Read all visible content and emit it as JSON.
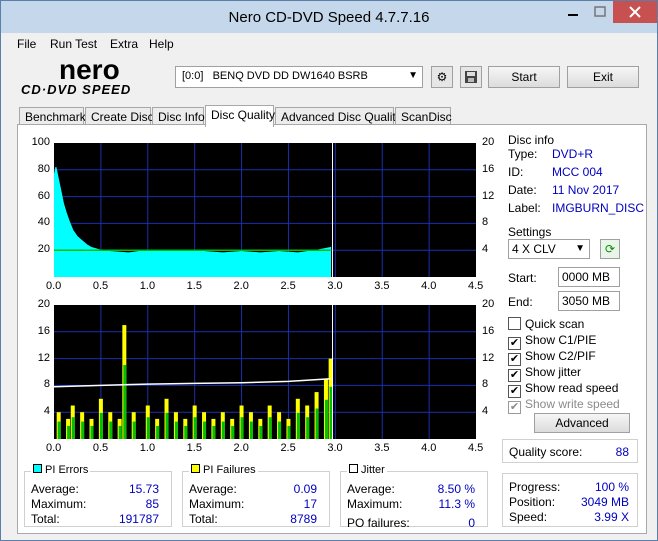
{
  "window": {
    "title": "Nero CD-DVD Speed 4.7.7.16",
    "accent": "#c5d7ea"
  },
  "menu": [
    "File",
    "Run Test",
    "Extra",
    "Help"
  ],
  "logo": {
    "brand": "nero",
    "product": "CD·DVD SPEED"
  },
  "drive": {
    "selected": "[0:0]   BENQ DVD DD DW1640 BSRB"
  },
  "toolbar": {
    "start_label": "Start",
    "exit_label": "Exit"
  },
  "tabs": [
    "Benchmark",
    "Create Disc",
    "Disc Info",
    "Disc Quality",
    "Advanced Disc Quality",
    "ScanDisc"
  ],
  "active_tab": "Disc Quality",
  "disc_info": {
    "title": "Disc info",
    "type_label": "Type:",
    "type": "DVD+R",
    "id_label": "ID:",
    "id": "MCC 004",
    "date_label": "Date:",
    "date": "11 Nov 2017",
    "label_label": "Label:",
    "label": "IMGBURN_DISC"
  },
  "settings": {
    "title": "Settings",
    "speed": "4 X CLV",
    "start_label": "Start:",
    "start": "0000 MB",
    "end_label": "End:",
    "end": "3050 MB",
    "quick_scan": "Quick scan",
    "show_c1": "Show C1/PIE",
    "show_c2": "Show C2/PIF",
    "show_jitter": "Show jitter",
    "show_read": "Show read speed",
    "show_write": "Show write speed",
    "advanced_label": "Advanced"
  },
  "quality": {
    "label": "Quality score:",
    "value": "88"
  },
  "progress": {
    "progress_label": "Progress:",
    "progress": "100 %",
    "position_label": "Position:",
    "position": "3049 MB",
    "speed_label": "Speed:",
    "speed": "3.99 X"
  },
  "pi_errors": {
    "title": "PI Errors",
    "color": "#00ffff",
    "avg_label": "Average:",
    "avg": "15.73",
    "max_label": "Maximum:",
    "max": "85",
    "total_label": "Total:",
    "total": "191787"
  },
  "pi_failures": {
    "title": "PI Failures",
    "color": "#ffff00",
    "avg_label": "Average:",
    "avg": "0.09",
    "max_label": "Maximum:",
    "max": "17",
    "total_label": "Total:",
    "total": "8789"
  },
  "jitter": {
    "title": "Jitter",
    "avg_label": "Average:",
    "avg": "8.50 %",
    "max_label": "Maximum:",
    "max": "11.3 %",
    "po_label": "PO failures:",
    "po": "0"
  },
  "chart_data": [
    {
      "type": "area",
      "series": [
        {
          "name": "PI Errors",
          "color": "#00ffff",
          "x": [
            0.0,
            0.02,
            0.05,
            0.08,
            0.1,
            0.13,
            0.16,
            0.2,
            0.25,
            0.3,
            0.35,
            0.4,
            0.5,
            0.6,
            0.8,
            1.0,
            1.2,
            1.4,
            1.6,
            1.8,
            2.0,
            2.2,
            2.4,
            2.6,
            2.8,
            2.95
          ],
          "values": [
            75,
            82,
            72,
            62,
            55,
            48,
            42,
            35,
            30,
            27,
            24,
            22,
            20,
            19,
            18,
            20,
            19,
            20,
            19,
            18,
            19,
            18,
            19,
            18,
            20,
            22
          ]
        },
        {
          "name": "Read speed",
          "color": "#00c000",
          "x": [
            0.0,
            2.95
          ],
          "values": [
            4,
            4
          ]
        }
      ],
      "xlim": [
        0,
        4.5
      ],
      "ylim": [
        0,
        100
      ],
      "y2lim": [
        0,
        20
      ],
      "xticks": [
        "0.0",
        "0.5",
        "1.0",
        "1.5",
        "2.0",
        "2.5",
        "3.0",
        "3.5",
        "4.0",
        "4.5"
      ],
      "yticks": [
        "20",
        "40",
        "60",
        "80",
        "100"
      ],
      "y2ticks": [
        "4",
        "8",
        "12",
        "16",
        "20"
      ],
      "grid": true
    },
    {
      "type": "bar",
      "series": [
        {
          "name": "PI Failures",
          "color": "#ffff00",
          "x": [
            0.05,
            0.15,
            0.2,
            0.3,
            0.4,
            0.5,
            0.6,
            0.7,
            0.75,
            0.85,
            1.0,
            1.1,
            1.2,
            1.3,
            1.4,
            1.5,
            1.6,
            1.7,
            1.8,
            1.9,
            2.0,
            2.1,
            2.2,
            2.3,
            2.4,
            2.5,
            2.6,
            2.7,
            2.8,
            2.9,
            2.95
          ],
          "values": [
            4,
            3,
            5,
            4,
            3,
            6,
            4,
            3,
            17,
            4,
            5,
            3,
            6,
            4,
            3,
            5,
            4,
            3,
            4,
            3,
            5,
            4,
            3,
            5,
            4,
            3,
            6,
            5,
            7,
            9,
            12
          ]
        },
        {
          "name": "Jitter",
          "color": "#ffffff",
          "x": [
            0.0,
            0.5,
            1.0,
            1.5,
            2.0,
            2.5,
            2.95
          ],
          "values": [
            7.8,
            8.0,
            8.2,
            8.3,
            8.4,
            8.6,
            9.0
          ]
        }
      ],
      "xlim": [
        0,
        4.5
      ],
      "ylim": [
        0,
        20
      ],
      "y2lim": [
        0,
        20
      ],
      "xticks": [
        "0.0",
        "0.5",
        "1.0",
        "1.5",
        "2.0",
        "2.5",
        "3.0",
        "3.5",
        "4.0",
        "4.5"
      ],
      "yticks": [
        "4",
        "8",
        "12",
        "16",
        "20"
      ],
      "y2ticks": [
        "4",
        "8",
        "12",
        "16",
        "20"
      ],
      "grid": true
    }
  ]
}
